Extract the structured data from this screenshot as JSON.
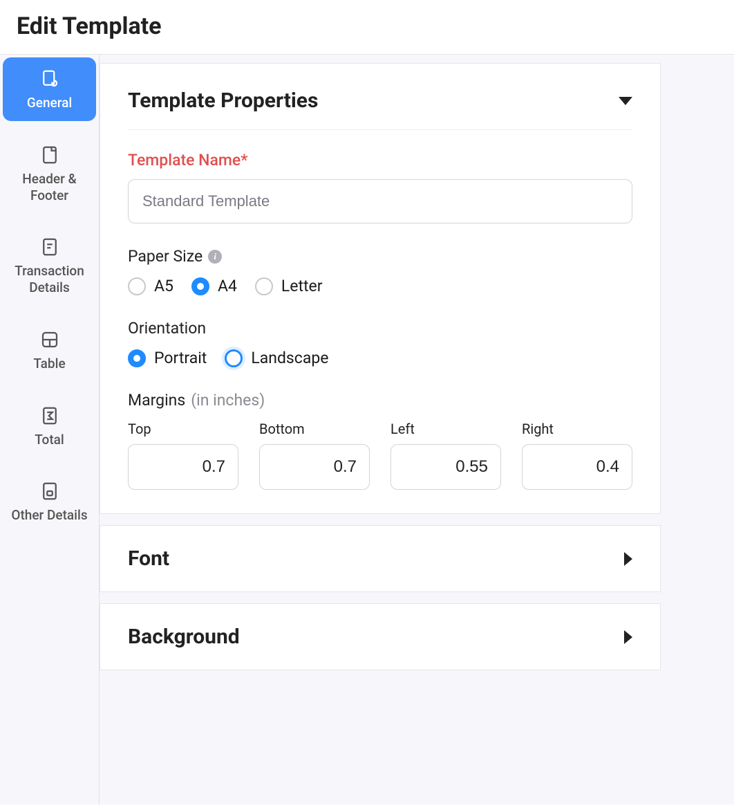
{
  "page": {
    "title": "Edit Template"
  },
  "sidebar": {
    "items": [
      {
        "label": "General",
        "active": true
      },
      {
        "label": "Header & Footer",
        "active": false
      },
      {
        "label": "Transaction Details",
        "active": false
      },
      {
        "label": "Table",
        "active": false
      },
      {
        "label": "Total",
        "active": false
      },
      {
        "label": "Other Details",
        "active": false
      }
    ]
  },
  "properties": {
    "section_title": "Template Properties",
    "name_label": "Template Name*",
    "name_value": "Standard Template",
    "paper_size": {
      "label": "Paper Size",
      "options": [
        "A5",
        "A4",
        "Letter"
      ],
      "selected": "A4"
    },
    "orientation": {
      "label": "Orientation",
      "options": [
        "Portrait",
        "Landscape"
      ],
      "selected": "Portrait",
      "focused": "Landscape"
    },
    "margins": {
      "label": "Margins",
      "unit": "(in inches)",
      "cols": [
        {
          "label": "Top",
          "value": "0.7"
        },
        {
          "label": "Bottom",
          "value": "0.7"
        },
        {
          "label": "Left",
          "value": "0.55"
        },
        {
          "label": "Right",
          "value": "0.4"
        }
      ]
    }
  },
  "collapsed_sections": [
    {
      "title": "Font"
    },
    {
      "title": "Background"
    }
  ]
}
